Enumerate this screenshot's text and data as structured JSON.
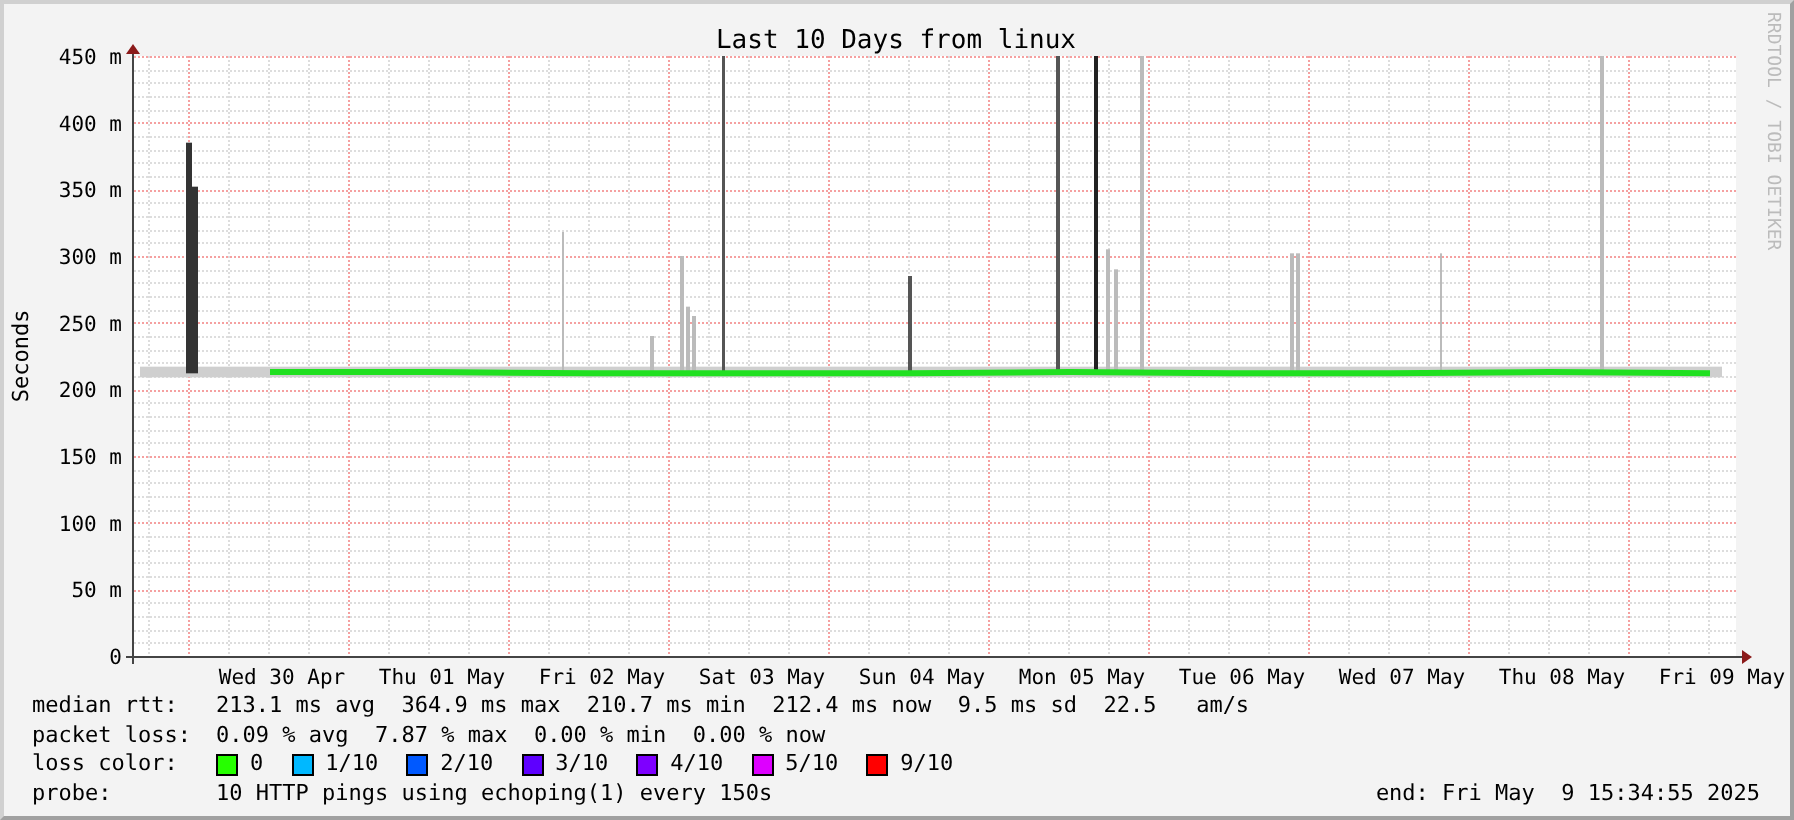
{
  "title": "Last 10 Days from linux",
  "side_credit": "RRDTOOL / TOBI OETIKER",
  "chart_data": {
    "type": "line",
    "ylabel": "Seconds",
    "ylim": [
      0,
      450
    ],
    "grid": true,
    "yticks": [
      {
        "value": 0,
        "label": "0"
      },
      {
        "value": 50,
        "label": "50 m"
      },
      {
        "value": 100,
        "label": "100 m"
      },
      {
        "value": 150,
        "label": "150 m"
      },
      {
        "value": 200,
        "label": "200 m"
      },
      {
        "value": 250,
        "label": "250 m"
      },
      {
        "value": 300,
        "label": "300 m"
      },
      {
        "value": 350,
        "label": "350 m"
      },
      {
        "value": 400,
        "label": "400 m"
      },
      {
        "value": 450,
        "label": "450 m"
      }
    ],
    "categories": [
      "Wed 30 Apr",
      "Thu 01 May",
      "Fri 02 May",
      "Sat 03 May",
      "Sun 04 May",
      "Mon 05 May",
      "Tue 06 May",
      "Wed 07 May",
      "Thu 08 May",
      "Fri 09 May"
    ],
    "series": [
      {
        "color": "#20e020",
        "values": [
          213,
          213,
          212,
          212,
          212,
          213,
          212,
          212,
          213,
          212
        ]
      }
    ]
  },
  "stats": [
    {
      "label": "median rtt:",
      "text": "213.1 ms avg  364.9 ms max  210.7 ms min  212.4 ms now  9.5 ms sd  22.5   am/s"
    },
    {
      "label": "packet loss:",
      "text": "0.09 % avg  7.87 % max  0.00 % min  0.00 % now"
    }
  ],
  "loss_color": {
    "label": "loss color:",
    "items": [
      {
        "label": "0",
        "color": "#26ff00"
      },
      {
        "label": "1/10",
        "color": "#00b8ff"
      },
      {
        "label": "2/10",
        "color": "#0059ff"
      },
      {
        "label": "3/10",
        "color": "#5e00ff"
      },
      {
        "label": "4/10",
        "color": "#7e00ff"
      },
      {
        "label": "5/10",
        "color": "#dd00ff"
      },
      {
        "label": "9/10",
        "color": "#ff0000"
      }
    ]
  },
  "probe": {
    "label": "probe:",
    "text": "10 HTTP pings using echoping(1) every 150s"
  },
  "end": "end: Fri May  9 15:34:55 2025"
}
